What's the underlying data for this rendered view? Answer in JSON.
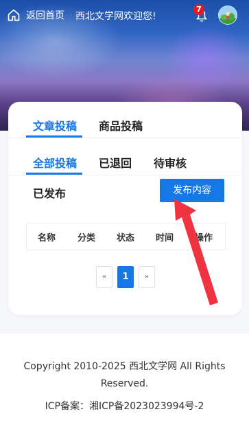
{
  "header": {
    "home_label": "返回首页",
    "welcome": "西北文学网欢迎您!",
    "notification_count": "7",
    "icons": [
      "home-icon",
      "bell-icon",
      "avatar"
    ]
  },
  "tabs": {
    "primary": [
      {
        "label": "文章投稿",
        "active": true
      },
      {
        "label": "商品投稿",
        "active": false
      }
    ],
    "filters": [
      {
        "label": "全部投稿",
        "active": true
      },
      {
        "label": "已退回",
        "active": false
      },
      {
        "label": "待审核",
        "active": false
      },
      {
        "label": "已发布",
        "active": false
      }
    ]
  },
  "publish_button": "发布内容",
  "table": {
    "columns": [
      "名称",
      "分类",
      "状态",
      "时间",
      "操作"
    ]
  },
  "pagination": {
    "prev": "«",
    "current": "1",
    "next": "»"
  },
  "footer": {
    "copyright_line1": "Copyright 2010-2025 西北文学网  All Rights",
    "copyright_line2": "Reserved.",
    "icp": "ICP备案：湘ICP备2023023994号-2"
  },
  "colors": {
    "accent": "#1677e6",
    "badge": "#e01b24",
    "annotation_arrow": "#ef3340"
  }
}
